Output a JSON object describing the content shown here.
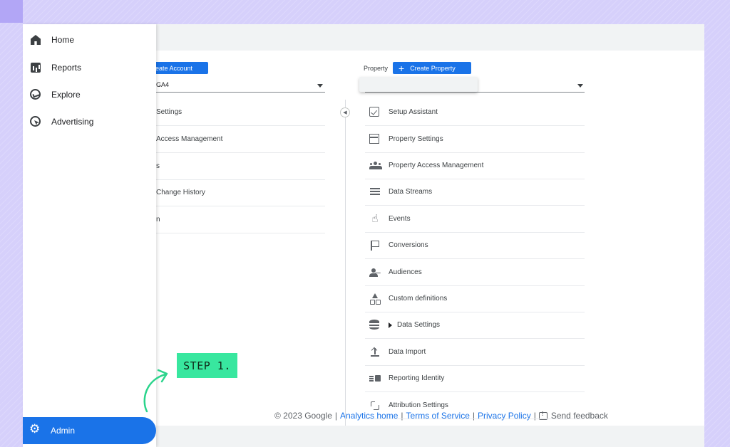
{
  "colors": {
    "accent": "#1a73e8",
    "step_tag": "#38e79f",
    "backdrop": "#d6d0fb"
  },
  "sidebar": {
    "items": [
      {
        "label": "Home",
        "icon": "home-icon"
      },
      {
        "label": "Reports",
        "icon": "reports-icon"
      },
      {
        "label": "Explore",
        "icon": "explore-icon"
      },
      {
        "label": "Advertising",
        "icon": "advertising-icon"
      }
    ],
    "admin": {
      "label": "Admin",
      "icon": "gear-icon"
    }
  },
  "account": {
    "create_label": "reate Account",
    "selected": "GA4",
    "rows": [
      "Settings",
      "Access Management",
      "s",
      "Change History",
      "n"
    ]
  },
  "property": {
    "label": "Property",
    "create_label": "Create Property",
    "rows": [
      {
        "label": "Setup Assistant",
        "icon": "checklist-icon"
      },
      {
        "label": "Property Settings",
        "icon": "settings-layout-icon"
      },
      {
        "label": "Property Access Management",
        "icon": "people-icon"
      },
      {
        "label": "Data Streams",
        "icon": "streams-icon"
      },
      {
        "label": "Events",
        "icon": "touch-icon"
      },
      {
        "label": "Conversions",
        "icon": "flag-icon"
      },
      {
        "label": "Audiences",
        "icon": "audience-icon"
      },
      {
        "label": "Custom definitions",
        "icon": "shapes-icon"
      },
      {
        "label": "Data Settings",
        "icon": "database-icon"
      },
      {
        "label": "Data Import",
        "icon": "upload-icon"
      },
      {
        "label": "Reporting Identity",
        "icon": "identity-icon"
      },
      {
        "label": "Attribution Settings",
        "icon": "attribution-icon"
      }
    ]
  },
  "footer": {
    "copyright": "© 2023 Google",
    "analytics_home": "Analytics home",
    "terms": "Terms of Service",
    "privacy": "Privacy Policy",
    "feedback": "Send feedback"
  },
  "annotation": {
    "step": "STEP 1."
  }
}
